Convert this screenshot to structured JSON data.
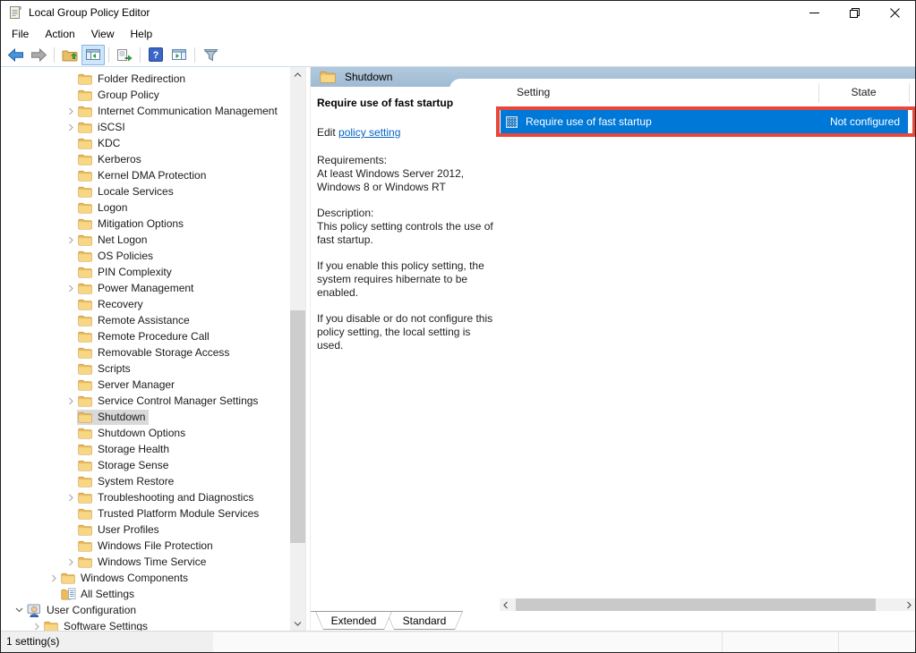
{
  "window": {
    "title": "Local Group Policy Editor",
    "controls": [
      {
        "id": "minimize",
        "icon": "minimize-icon"
      },
      {
        "id": "restore",
        "icon": "restore-icon"
      },
      {
        "id": "close",
        "icon": "close-icon"
      }
    ]
  },
  "menu": {
    "items": [
      "File",
      "Action",
      "View",
      "Help"
    ]
  },
  "toolbar": {
    "buttons": [
      {
        "id": "back",
        "icon": "back-icon",
        "toggled": false
      },
      {
        "id": "forward",
        "icon": "forward-icon",
        "toggled": false
      },
      {
        "id": "separator"
      },
      {
        "id": "up-one-level",
        "icon": "up-folder-icon",
        "toggled": false
      },
      {
        "id": "show-console-tree",
        "icon": "console-tree-icon",
        "toggled": true
      },
      {
        "id": "separator"
      },
      {
        "id": "export-list",
        "icon": "export-list-icon",
        "toggled": false
      },
      {
        "id": "separator"
      },
      {
        "id": "help",
        "icon": "help-icon",
        "toggled": false
      },
      {
        "id": "show-action-pane",
        "icon": "action-pane-icon",
        "toggled": false
      },
      {
        "id": "separator"
      },
      {
        "id": "filter",
        "icon": "filter-icon",
        "toggled": false
      }
    ]
  },
  "tree": {
    "items": [
      {
        "label": "Folder Redirection",
        "level": 3,
        "chevron": "none",
        "icon": "folder",
        "selected": false
      },
      {
        "label": "Group Policy",
        "level": 3,
        "chevron": "none",
        "icon": "folder",
        "selected": false
      },
      {
        "label": "Internet Communication Management",
        "level": 3,
        "chevron": "right",
        "icon": "folder",
        "selected": false
      },
      {
        "label": "iSCSI",
        "level": 3,
        "chevron": "right",
        "icon": "folder",
        "selected": false
      },
      {
        "label": "KDC",
        "level": 3,
        "chevron": "none",
        "icon": "folder",
        "selected": false
      },
      {
        "label": "Kerberos",
        "level": 3,
        "chevron": "none",
        "icon": "folder",
        "selected": false
      },
      {
        "label": "Kernel DMA Protection",
        "level": 3,
        "chevron": "none",
        "icon": "folder",
        "selected": false
      },
      {
        "label": "Locale Services",
        "level": 3,
        "chevron": "none",
        "icon": "folder",
        "selected": false
      },
      {
        "label": "Logon",
        "level": 3,
        "chevron": "none",
        "icon": "folder",
        "selected": false
      },
      {
        "label": "Mitigation Options",
        "level": 3,
        "chevron": "none",
        "icon": "folder",
        "selected": false
      },
      {
        "label": "Net Logon",
        "level": 3,
        "chevron": "right",
        "icon": "folder",
        "selected": false
      },
      {
        "label": "OS Policies",
        "level": 3,
        "chevron": "none",
        "icon": "folder",
        "selected": false
      },
      {
        "label": "PIN Complexity",
        "level": 3,
        "chevron": "none",
        "icon": "folder",
        "selected": false
      },
      {
        "label": "Power Management",
        "level": 3,
        "chevron": "right",
        "icon": "folder",
        "selected": false
      },
      {
        "label": "Recovery",
        "level": 3,
        "chevron": "none",
        "icon": "folder",
        "selected": false
      },
      {
        "label": "Remote Assistance",
        "level": 3,
        "chevron": "none",
        "icon": "folder",
        "selected": false
      },
      {
        "label": "Remote Procedure Call",
        "level": 3,
        "chevron": "none",
        "icon": "folder",
        "selected": false
      },
      {
        "label": "Removable Storage Access",
        "level": 3,
        "chevron": "none",
        "icon": "folder",
        "selected": false
      },
      {
        "label": "Scripts",
        "level": 3,
        "chevron": "none",
        "icon": "folder",
        "selected": false
      },
      {
        "label": "Server Manager",
        "level": 3,
        "chevron": "none",
        "icon": "folder",
        "selected": false
      },
      {
        "label": "Service Control Manager Settings",
        "level": 3,
        "chevron": "right",
        "icon": "folder",
        "selected": false
      },
      {
        "label": "Shutdown",
        "level": 3,
        "chevron": "none",
        "icon": "folder",
        "selected": true
      },
      {
        "label": "Shutdown Options",
        "level": 3,
        "chevron": "none",
        "icon": "folder",
        "selected": false
      },
      {
        "label": "Storage Health",
        "level": 3,
        "chevron": "none",
        "icon": "folder",
        "selected": false
      },
      {
        "label": "Storage Sense",
        "level": 3,
        "chevron": "none",
        "icon": "folder",
        "selected": false
      },
      {
        "label": "System Restore",
        "level": 3,
        "chevron": "none",
        "icon": "folder",
        "selected": false
      },
      {
        "label": "Troubleshooting and Diagnostics",
        "level": 3,
        "chevron": "right",
        "icon": "folder",
        "selected": false
      },
      {
        "label": "Trusted Platform Module Services",
        "level": 3,
        "chevron": "none",
        "icon": "folder",
        "selected": false
      },
      {
        "label": "User Profiles",
        "level": 3,
        "chevron": "none",
        "icon": "folder",
        "selected": false
      },
      {
        "label": "Windows File Protection",
        "level": 3,
        "chevron": "none",
        "icon": "folder",
        "selected": false
      },
      {
        "label": "Windows Time Service",
        "level": 3,
        "chevron": "right",
        "icon": "folder",
        "selected": false
      },
      {
        "label": "Windows Components",
        "level": 2,
        "chevron": "right",
        "icon": "folder",
        "selected": false
      },
      {
        "label": "All Settings",
        "level": 2,
        "chevron": "none",
        "icon": "all-settings",
        "selected": false
      },
      {
        "label": "User Configuration",
        "level": 0,
        "chevron": "down",
        "icon": "user-config",
        "selected": false
      },
      {
        "label": "Software Settings",
        "level": 1,
        "chevron": "right",
        "icon": "folder",
        "selected": false
      }
    ]
  },
  "band": {
    "title": "Shutdown",
    "icon": "folder-icon"
  },
  "detail": {
    "title": "Require use of fast startup",
    "edit_prefix": "Edit ",
    "edit_link": "policy setting",
    "paragraphs": [
      "Requirements:\nAt least Windows Server 2012,\nWindows 8 or Windows RT",
      "Description:\nThis policy setting controls the use of\nfast startup.",
      "If you enable this policy setting, the\nsystem requires hibernate to be\nenabled.",
      "If you disable or do not configure this\npolicy setting, the local setting is\nused."
    ]
  },
  "list": {
    "columns": [
      "Setting",
      "State"
    ],
    "rows": [
      {
        "setting": "Require use of fast startup",
        "state": "Not configured",
        "selected": true,
        "annotated": true,
        "icon": "policy-setting-icon"
      }
    ]
  },
  "tabs": {
    "items": [
      "Extended",
      "Standard"
    ],
    "active": 0
  },
  "status": {
    "text": "1 setting(s)"
  },
  "colors": {
    "selection_blue": "#0078d7",
    "annotation_red": "#e8473c",
    "band_blue": "#b2c9dd",
    "tree_selection_gray": "#d9d9d9",
    "link_blue": "#0563c1"
  }
}
